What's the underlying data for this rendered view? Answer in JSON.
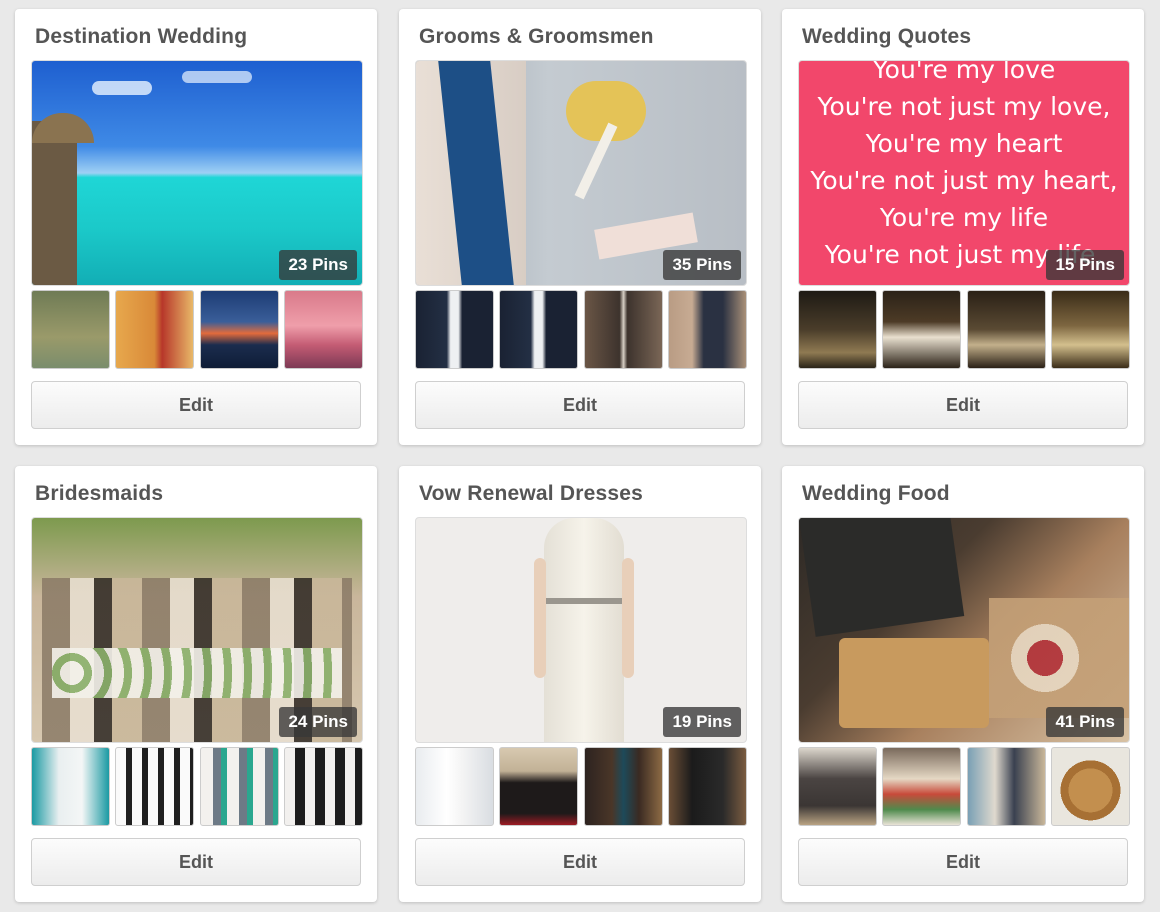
{
  "boards": [
    {
      "title": "Destination Wedding",
      "pins": "23 Pins",
      "edit": "Edit"
    },
    {
      "title": "Grooms & Groomsmen",
      "pins": "35 Pins",
      "edit": "Edit"
    },
    {
      "title": "Wedding Quotes",
      "pins": "15 Pins",
      "edit": "Edit"
    },
    {
      "title": "Bridesmaids",
      "pins": "24 Pins",
      "edit": "Edit"
    },
    {
      "title": "Vow Renewal Dresses",
      "pins": "19 Pins",
      "edit": "Edit"
    },
    {
      "title": "Wedding Food",
      "pins": "41 Pins",
      "edit": "Edit"
    }
  ],
  "quote_lines": [
    "You're my love",
    "You're not just my love,",
    "You're my heart",
    "You're not just my heart,",
    "You're my life",
    "You're not just my life,"
  ],
  "colors": {
    "background": "#e9e9e9",
    "card": "#ffffff",
    "title": "#555555",
    "quote_pink": "#f2476b",
    "badge": "#373737"
  }
}
